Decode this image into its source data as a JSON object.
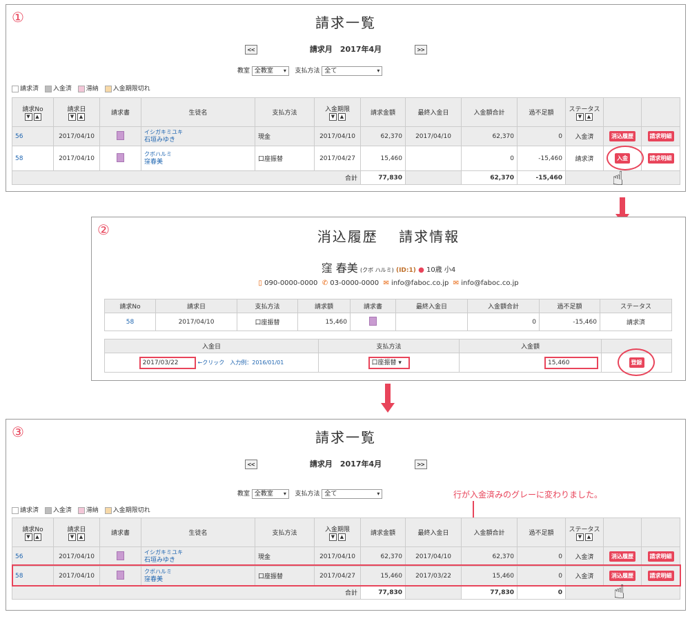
{
  "steps": [
    "①",
    "②",
    "③"
  ],
  "panel1": {
    "title": "請求一覧",
    "prev": "<<",
    "next": ">>",
    "month": "請求月　2017年4月",
    "classroom_label": "教室",
    "classroom_value": "全教室",
    "pay_label": "支払方法",
    "pay_value": "全て",
    "legend": [
      "請求済",
      "入金済",
      "滞納",
      "入金期限切れ"
    ],
    "legend_colors": [
      "#ffffff",
      "#bdbdbd",
      "#f3c7d8",
      "#f7d9a8"
    ],
    "headers": [
      "請求No",
      "請求日",
      "請求書",
      "生徒名",
      "支払方法",
      "入金期限",
      "請求金額",
      "最終入金日",
      "入金額合計",
      "過不足額",
      "ステータス"
    ],
    "rows": [
      {
        "no": "56",
        "date": "2017/04/10",
        "kana": "イシガキミユキ",
        "name": "石垣みゆき",
        "method": "現金",
        "due": "2017/04/10",
        "amount": "62,370",
        "last": "2017/04/10",
        "paid": "62,370",
        "diff": "0",
        "status": "入金済",
        "btn1": "消込履歴",
        "btn2": "請求明細"
      },
      {
        "no": "58",
        "date": "2017/04/10",
        "kana": "クボハルミ",
        "name": "窪春美",
        "method": "口座振替",
        "due": "2017/04/27",
        "amount": "15,460",
        "last": "",
        "paid": "0",
        "diff": "-15,460",
        "status": "請求済",
        "btn1": "入金",
        "btn2": "請求明細"
      }
    ],
    "total_label": "合計",
    "total_amount": "77,830",
    "total_paid": "62,370",
    "total_diff": "-15,460"
  },
  "panel2": {
    "title": "消込履歴　 請求情報",
    "student_name": "窪 春美",
    "student_kana": "(クボ ハルミ)",
    "student_id": "(ID:1)",
    "age": "10歳",
    "grade": "小4",
    "mobile": "090-0000-0000",
    "phone": "03-0000-0000",
    "email1": "info@faboc.co.jp",
    "email2": "info@faboc.co.jp",
    "info_headers": [
      "請求No",
      "請求日",
      "支払方法",
      "請求額",
      "請求書",
      "最終入金日",
      "入金額合計",
      "過不足額",
      "ステータス"
    ],
    "info_row": {
      "no": "58",
      "date": "2017/04/10",
      "method": "口座振替",
      "amount": "15,460",
      "last": "",
      "paid": "0",
      "diff": "-15,460",
      "status": "請求済"
    },
    "entry_headers": [
      "入金日",
      "支払方法",
      "入金額"
    ],
    "entry_date": "2017/03/22",
    "entry_hint": "←クリック　入力例：2016/01/01",
    "entry_method": "口座振替",
    "entry_amount": "15,460",
    "register": "登録"
  },
  "panel3": {
    "title": "請求一覧",
    "note": "行が入金済みのグレーに変わりました。",
    "rows": [
      {
        "no": "56",
        "date": "2017/04/10",
        "kana": "イシガキミユキ",
        "name": "石垣みゆき",
        "method": "現金",
        "due": "2017/04/10",
        "amount": "62,370",
        "last": "2017/04/10",
        "paid": "62,370",
        "diff": "0",
        "status": "入金済",
        "btn1": "消込履歴",
        "btn2": "請求明細"
      },
      {
        "no": "58",
        "date": "2017/04/10",
        "kana": "クボハルミ",
        "name": "窪春美",
        "method": "口座振替",
        "due": "2017/04/27",
        "amount": "15,460",
        "last": "2017/03/22",
        "paid": "15,460",
        "diff": "0",
        "status": "入金済",
        "btn1": "消込履歴",
        "btn2": "請求明細"
      }
    ],
    "total_amount": "77,830",
    "total_paid": "77,830",
    "total_diff": "0"
  }
}
